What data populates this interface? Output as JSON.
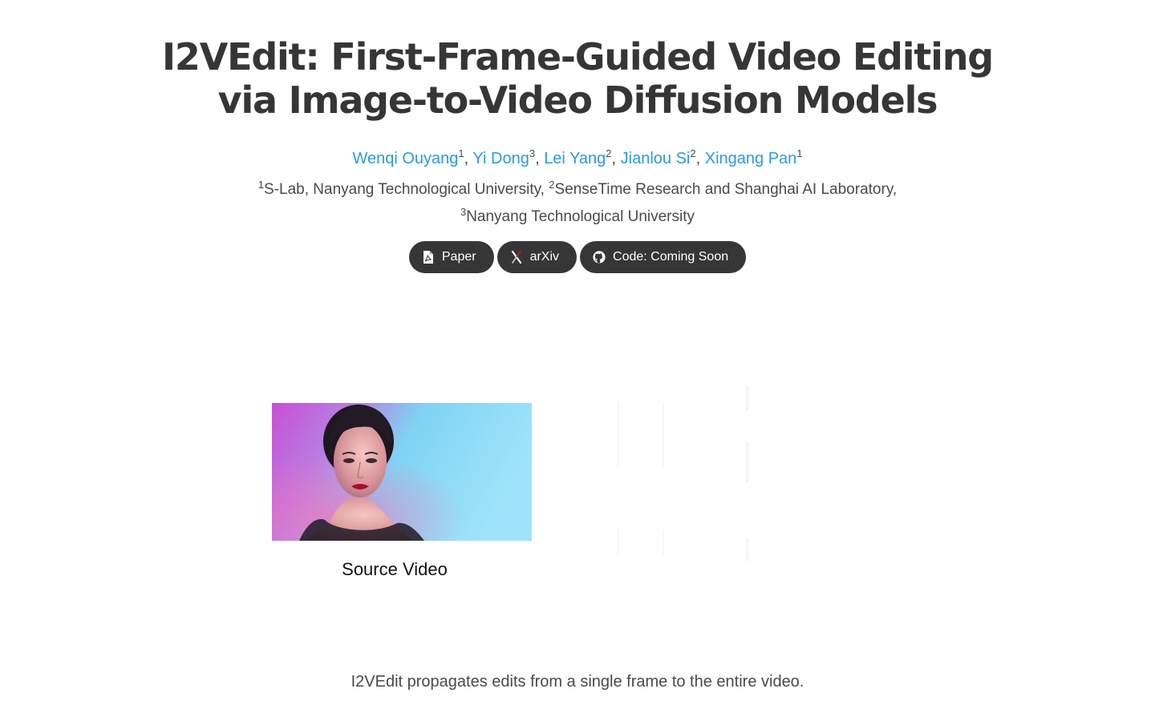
{
  "title": {
    "line1": "I2VEdit: First-Frame-Guided Video Editing",
    "line2": "via Image-to-Video Diffusion Models"
  },
  "authors": [
    {
      "name": "Wenqi Ouyang",
      "sup": "1",
      "sep": ", "
    },
    {
      "name": "Yi Dong",
      "sup": "3",
      "sep": ", "
    },
    {
      "name": "Lei Yang",
      "sup": "2",
      "sep": ", "
    },
    {
      "name": "Jianlou Si",
      "sup": "2",
      "sep": ", "
    },
    {
      "name": "Xingang Pan",
      "sup": "1",
      "sep": ""
    }
  ],
  "affiliations": {
    "a1_sup": "1",
    "a1": "S-Lab, Nanyang Technological University, ",
    "a2_sup": "2",
    "a2": "SenseTime Research and Shanghai AI Laboratory,",
    "a3_sup": "3",
    "a3": "Nanyang Technological University"
  },
  "buttons": {
    "paper": {
      "label": "Paper",
      "icon": "pdf-icon"
    },
    "arxiv": {
      "label": "arXiv",
      "icon": "arxiv-icon"
    },
    "code": {
      "label": "Code: Coming Soon",
      "icon": "github-icon"
    }
  },
  "video": {
    "caption": "Source Video"
  },
  "summary": "I2VEdit propagates edits from a single frame to the entire video.",
  "colors": {
    "link": "#2a9be0",
    "button_bg": "#363636",
    "title": "#363636"
  }
}
